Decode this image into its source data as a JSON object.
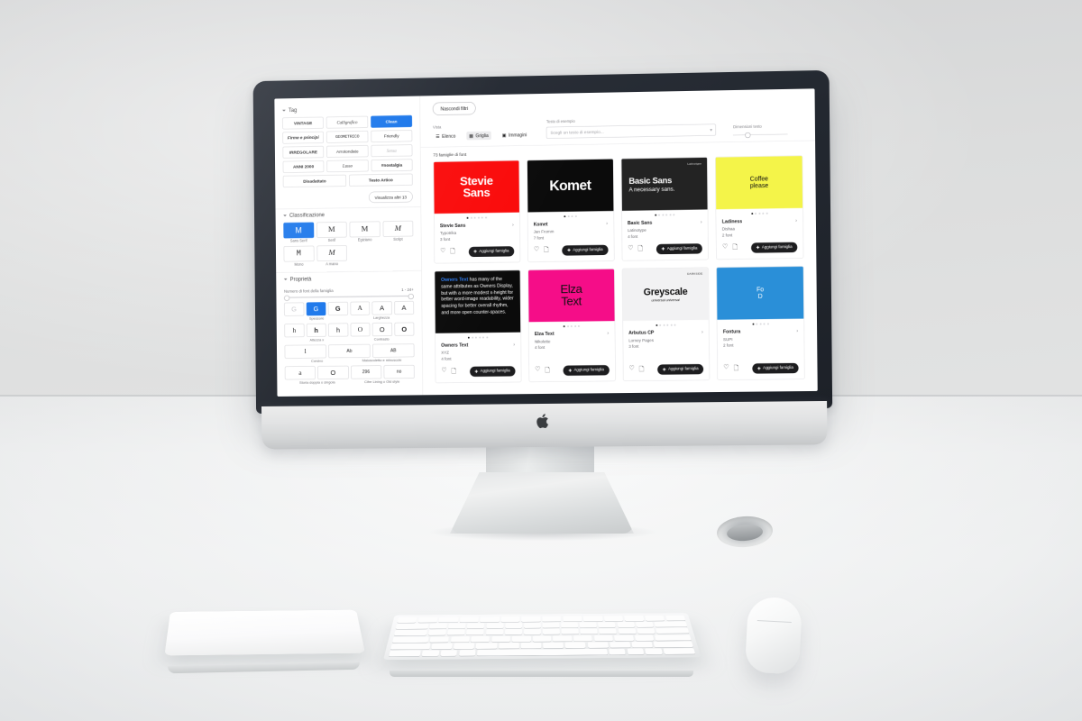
{
  "scene": {
    "description": "iMac on white desk with Magic Keyboard, Magic Trackpad and Magic Mouse",
    "wall_color": "#d7d8d9",
    "desk_color": "#f5f6f6",
    "bezel_color": "#262b33",
    "logo": "apple-logo"
  },
  "app": {
    "accent_color": "#1573ea",
    "sidebar": {
      "tag_section": {
        "title": "Tag",
        "tags": [
          {
            "label": "VINTAGE",
            "style": "bold",
            "active": false
          },
          {
            "label": "Calligrafico",
            "style": "italic-serif",
            "active": false
          },
          {
            "label": "Clean",
            "style": "normal",
            "active": true
          },
          {
            "label": "Firme e principi",
            "style": "bold-italic",
            "active": false
          },
          {
            "label": "GEOMETRICO",
            "style": "mono",
            "active": false
          },
          {
            "label": "Friendly",
            "style": "normal",
            "active": false
          },
          {
            "label": "IRREGOLARE",
            "style": "bold",
            "active": false
          },
          {
            "label": "Arrotondato",
            "style": "normal",
            "active": false
          },
          {
            "label": "Sensa",
            "style": "light-script",
            "active": false
          },
          {
            "label": "ANNI 2000",
            "style": "bold",
            "active": false
          },
          {
            "label": "Lusso",
            "style": "italic-serif",
            "active": false
          },
          {
            "label": "#nostalgia",
            "style": "bold",
            "active": false
          }
        ],
        "wide_tags": [
          {
            "label": "Disadattato"
          },
          {
            "label": "Testo Artico"
          }
        ],
        "more_button": "Visualizza altri 13"
      },
      "classification_section": {
        "title": "Classificazione",
        "items": [
          {
            "glyph": "M",
            "label": "Sans Serif",
            "active": true
          },
          {
            "glyph": "M",
            "label": "Serif",
            "active": false
          },
          {
            "glyph": "M",
            "label": "Egiziano",
            "active": false
          },
          {
            "glyph": "M",
            "label": "Script",
            "active": false
          },
          {
            "glyph": "M",
            "label": "Mono",
            "active": false
          },
          {
            "glyph": "M",
            "label": "A mano",
            "active": false
          }
        ]
      },
      "properties_section": {
        "title": "Proprietà",
        "family_size": {
          "label": "Numero di font della famiglia",
          "range_label": "1 - 24+",
          "min": 1,
          "max": 24
        },
        "rows": [
          {
            "items": [
              {
                "glyph": "G",
                "active": false,
                "style": "light"
              },
              {
                "glyph": "G",
                "active": true,
                "style": "normal"
              },
              {
                "glyph": "G",
                "active": false,
                "style": "bold"
              },
              {
                "glyph": "A",
                "active": false,
                "style": "serif"
              },
              {
                "glyph": "A",
                "active": false,
                "style": "normal"
              },
              {
                "glyph": "A",
                "active": false,
                "style": "normal"
              }
            ],
            "labels": [
              "Spessore",
              "Larghezza"
            ]
          },
          {
            "items": [
              {
                "glyph": "h",
                "active": false,
                "style": "serif"
              },
              {
                "glyph": "h",
                "active": false,
                "style": "bold"
              },
              {
                "glyph": "h",
                "active": false,
                "style": "normal"
              },
              {
                "glyph": "O",
                "active": false,
                "style": "serif"
              },
              {
                "glyph": "O",
                "active": false,
                "style": "normal"
              },
              {
                "glyph": "O",
                "active": false,
                "style": "bold"
              }
            ],
            "labels": [
              "Altezza x",
              "Contrasto"
            ]
          },
          {
            "items": [
              {
                "glyph": "l",
                "active": false,
                "style": "serif"
              },
              {
                "glyph": "Ab",
                "active": false,
                "style": "normal"
              },
              {
                "glyph": "AB",
                "active": false,
                "style": "normal"
              }
            ],
            "labels": [
              "Corsivo",
              "Maiuscoletto e minuscole"
            ]
          },
          {
            "items": [
              {
                "glyph": "a",
                "active": false,
                "style": "serif"
              },
              {
                "glyph": "O",
                "active": false,
                "style": "normal"
              },
              {
                "glyph": "296",
                "active": false,
                "style": "normal"
              },
              {
                "glyph": "no",
                "active": false,
                "style": "normal"
              }
            ],
            "labels": [
              "Storia doppia o singola",
              "Cifre Lining o Old style"
            ]
          }
        ]
      }
    },
    "toolbar": {
      "hide_filters": "Nascondi filtri",
      "view_label": "Vista",
      "views": [
        {
          "label": "Elenco",
          "icon": "list-icon",
          "active": false
        },
        {
          "label": "Griglia",
          "icon": "grid-icon",
          "active": true
        },
        {
          "label": "Immagini",
          "icon": "image-icon",
          "active": false
        }
      ],
      "sample_label": "Testo di esempio",
      "sample_placeholder": "Scegli un testo di esempio...",
      "size_label": "Dimensioni testo"
    },
    "results_count": "73 famiglie di font",
    "add_button_label": "Aggiungi famiglia",
    "cards": [
      {
        "specimen_text": "Stevie\nSans",
        "specimen_style": "sp-stevie",
        "name": "Stevie Sans",
        "foundry": "Typotrika",
        "fonts": "3 font",
        "dots_total": 6,
        "dots_on": 1,
        "mini": ""
      },
      {
        "specimen_text": "Komet",
        "specimen_style": "sp-komet",
        "name": "Komet",
        "foundry": "Jan Fromm",
        "fonts": "7 font",
        "dots_total": 4,
        "dots_on": 1,
        "mini": ""
      },
      {
        "specimen_text": "Basic Sans",
        "specimen_sub": "A necessary sans.",
        "specimen_style": "sp-basic",
        "name": "Basic Sans",
        "foundry": "Latinotype",
        "fonts": "4 font",
        "dots_total": 6,
        "dots_on": 1,
        "mini": "Latinotype"
      },
      {
        "specimen_text": "Coffee\nplease",
        "specimen_style": "sp-coffee",
        "name": "Ladiness",
        "foundry": "Dishaa",
        "fonts": "2 font",
        "dots_total": 5,
        "dots_on": 1,
        "mini": ""
      },
      {
        "specimen_text": "Owners Text has many of the same attributes as Owners Display, but with a more modest x-height for better word-image readability, wider spacing for better overall rhythm, and more open counter-spaces.",
        "specimen_style": "sp-owners",
        "name": "Owners Text",
        "foundry": "XYZ",
        "fonts": "4 font",
        "dots_total": 6,
        "dots_on": 1,
        "mini": ""
      },
      {
        "specimen_text": "Elza\nText",
        "specimen_style": "sp-elza",
        "name": "Elza Text",
        "foundry": "Nikolette",
        "fonts": "4 font",
        "dots_total": 5,
        "dots_on": 1,
        "mini": ""
      },
      {
        "specimen_text": "Greyscale",
        "specimen_sub": "universal universal",
        "specimen_style": "sp-grey",
        "name": "Arbutus CP",
        "foundry": "Lorney Pages",
        "fonts": "3 font",
        "dots_total": 6,
        "dots_on": 1,
        "mini": "DARKSIDE"
      },
      {
        "specimen_text": "Fo\nD",
        "specimen_style": "sp-fd",
        "name": "Fontura",
        "foundry": "SUPI",
        "fonts": "2 font",
        "dots_total": 5,
        "dots_on": 1,
        "mini": ""
      }
    ]
  }
}
